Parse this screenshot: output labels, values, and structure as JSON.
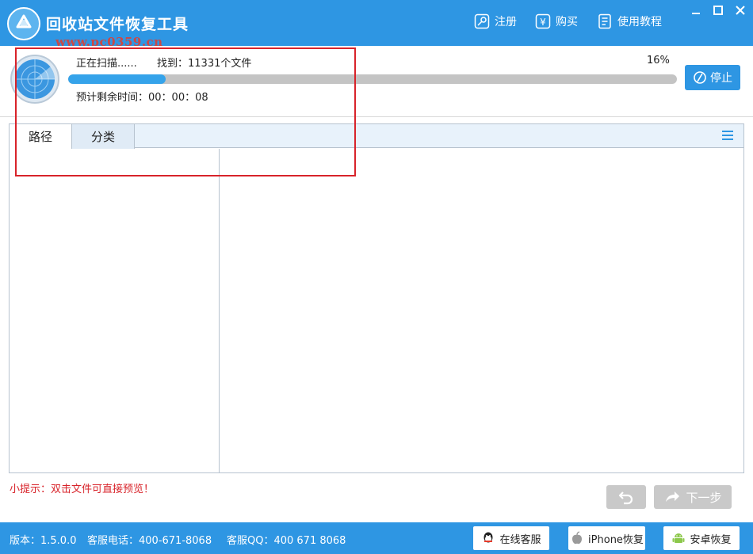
{
  "window": {
    "title": "回收站文件恢复工具",
    "watermark": "www.pc0359.cn",
    "actions": {
      "register": "注册",
      "buy": "购买",
      "tutorial": "使用教程"
    },
    "controls": {
      "minimize": "—",
      "maximize": "□",
      "close": "✕"
    }
  },
  "scan": {
    "status": "正在扫描......",
    "found": "找到：11331个文件",
    "percent_label": "16%",
    "progress": 0.16,
    "remaining": "预计剩余时间：00：00：08",
    "stop_label": "停止"
  },
  "tabs": [
    {
      "label": "路径"
    },
    {
      "label": "分类"
    }
  ],
  "tip": "小提示：双击文件可直接预览！",
  "nav": {
    "next_label": "下一步"
  },
  "footer": {
    "version": "版本：1.5.0.0",
    "phone": "客服电话：400-671-8068",
    "qq": "客服QQ：400 671 8068",
    "online_service": "在线客服",
    "iphone_recovery": "iPhone恢复",
    "android_recovery": "安卓恢复"
  },
  "colors": {
    "brand": "#2e96e3",
    "progress_fill": "#35a3ea",
    "progress_track": "#c4c4c4",
    "highlight": "#d8232a",
    "disabled_button": "#c9c9c9"
  },
  "icons": {
    "logo": "recycle-logo-icon",
    "register": "key-icon",
    "buy": "yen-icon",
    "tutorial": "book-icon",
    "radar": "radar-icon",
    "stop": "stop-icon",
    "menu": "menu-icon",
    "back": "undo-icon",
    "next": "forward-arrow-icon",
    "qq": "qq-icon",
    "apple": "apple-icon",
    "android": "android-icon"
  }
}
